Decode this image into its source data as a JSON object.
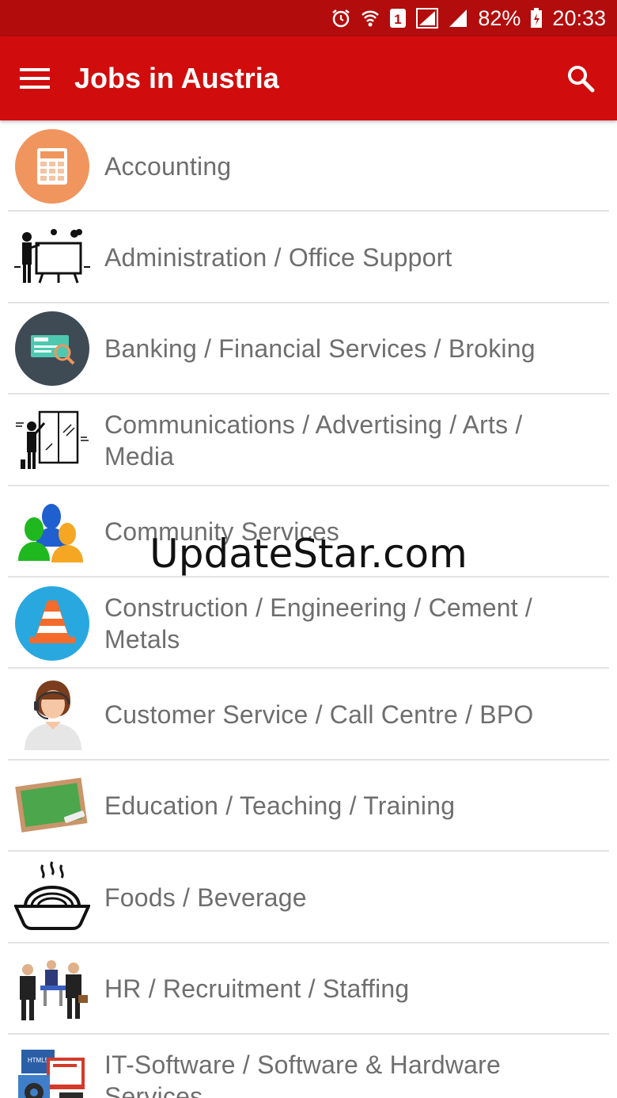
{
  "status_bar": {
    "battery": "82%",
    "time": "20:33",
    "sim": "1",
    "icons": [
      "alarm-icon",
      "wifi-icon",
      "sim-icon",
      "signal-icon",
      "signal-icon",
      "battery-icon"
    ]
  },
  "app_bar": {
    "title": "Jobs in Austria",
    "background": "#d10c0c",
    "status_background": "#b30c0c"
  },
  "categories": [
    {
      "label": "Accounting",
      "icon": "calculator-icon"
    },
    {
      "label": "Administration / Office Support",
      "icon": "presenter-board-icon"
    },
    {
      "label": "Banking / Financial Services / Broking",
      "icon": "cheque-icon"
    },
    {
      "label": "Communications / Advertising / Arts / Media",
      "icon": "artist-canvas-icon"
    },
    {
      "label": "Community Services",
      "icon": "people-group-icon"
    },
    {
      "label": "Construction / Engineering / Cement / Metals",
      "icon": "traffic-cone-icon"
    },
    {
      "label": "Customer Service / Call Centre / BPO",
      "icon": "call-centre-agent-icon"
    },
    {
      "label": "Education / Teaching / Training",
      "icon": "chalkboard-icon"
    },
    {
      "label": "Foods / Beverage",
      "icon": "food-bowl-icon"
    },
    {
      "label": "HR / Recruitment / Staffing",
      "icon": "interview-icon"
    },
    {
      "label": "IT-Software / Software & Hardware Services",
      "icon": "html5-computer-icon"
    }
  ],
  "watermark": "UpdateStar.com"
}
